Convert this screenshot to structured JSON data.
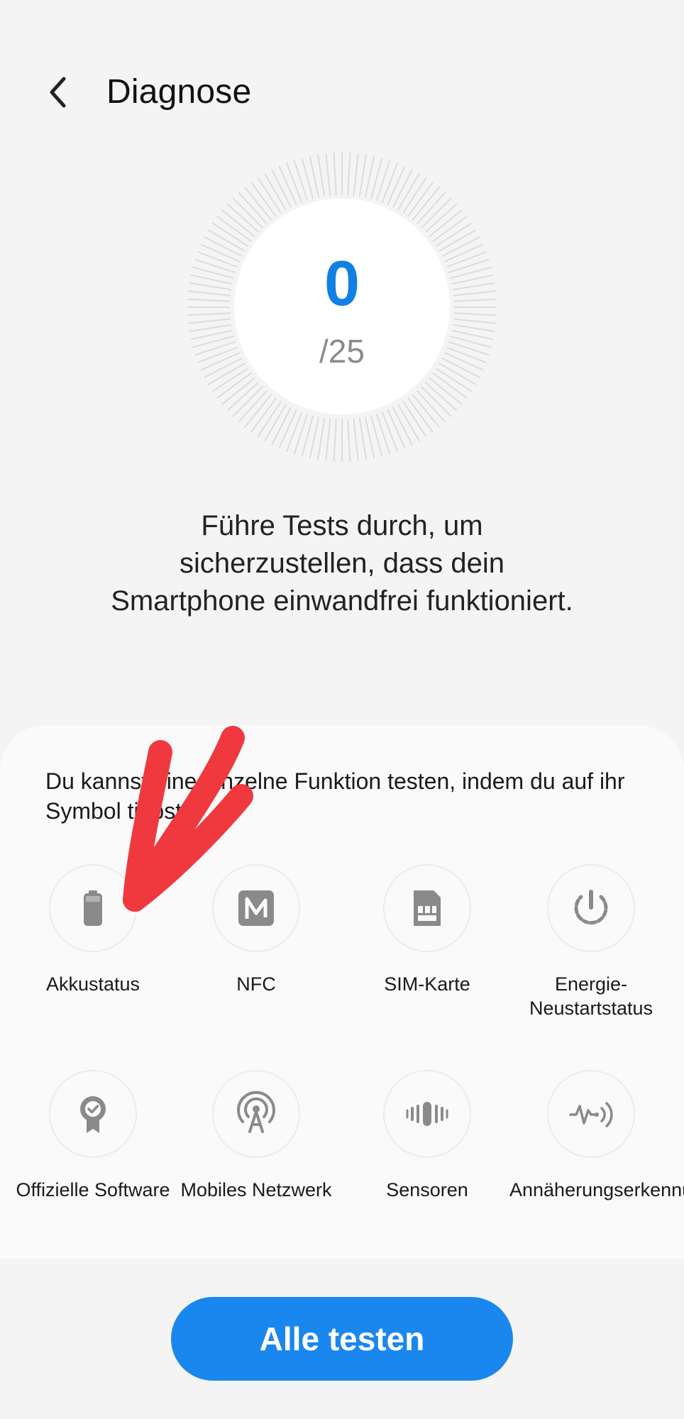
{
  "header": {
    "title": "Diagnose"
  },
  "score": {
    "value": "0",
    "total": "/25"
  },
  "intro": "Führe Tests durch, um sicherzustellen, dass dein Smartphone einwandfrei funktioniert.",
  "panel": {
    "hint": "Du kannst eine einzelne Funktion testen, indem du auf ihr Symbol tippst.",
    "tests": [
      {
        "label": "Akkustatus",
        "icon": "battery-icon"
      },
      {
        "label": "NFC",
        "icon": "nfc-icon"
      },
      {
        "label": "SIM-Karte",
        "icon": "sim-card-icon"
      },
      {
        "label": "Energie-Neustartstatus",
        "icon": "restart-icon"
      },
      {
        "label": "Offizielle Software",
        "icon": "certified-badge-icon"
      },
      {
        "label": "Mobiles Netzwerk",
        "icon": "cell-tower-icon"
      },
      {
        "label": "Sensoren",
        "icon": "vibration-sensor-icon"
      },
      {
        "label": "Annäherungserkennung",
        "icon": "proximity-icon"
      }
    ]
  },
  "cta": {
    "label": "Alle testen"
  },
  "colors": {
    "accent": "#1a87ee",
    "score": "#1180e5",
    "icon": "#8a8a8a",
    "annotation": "#f0393f"
  }
}
